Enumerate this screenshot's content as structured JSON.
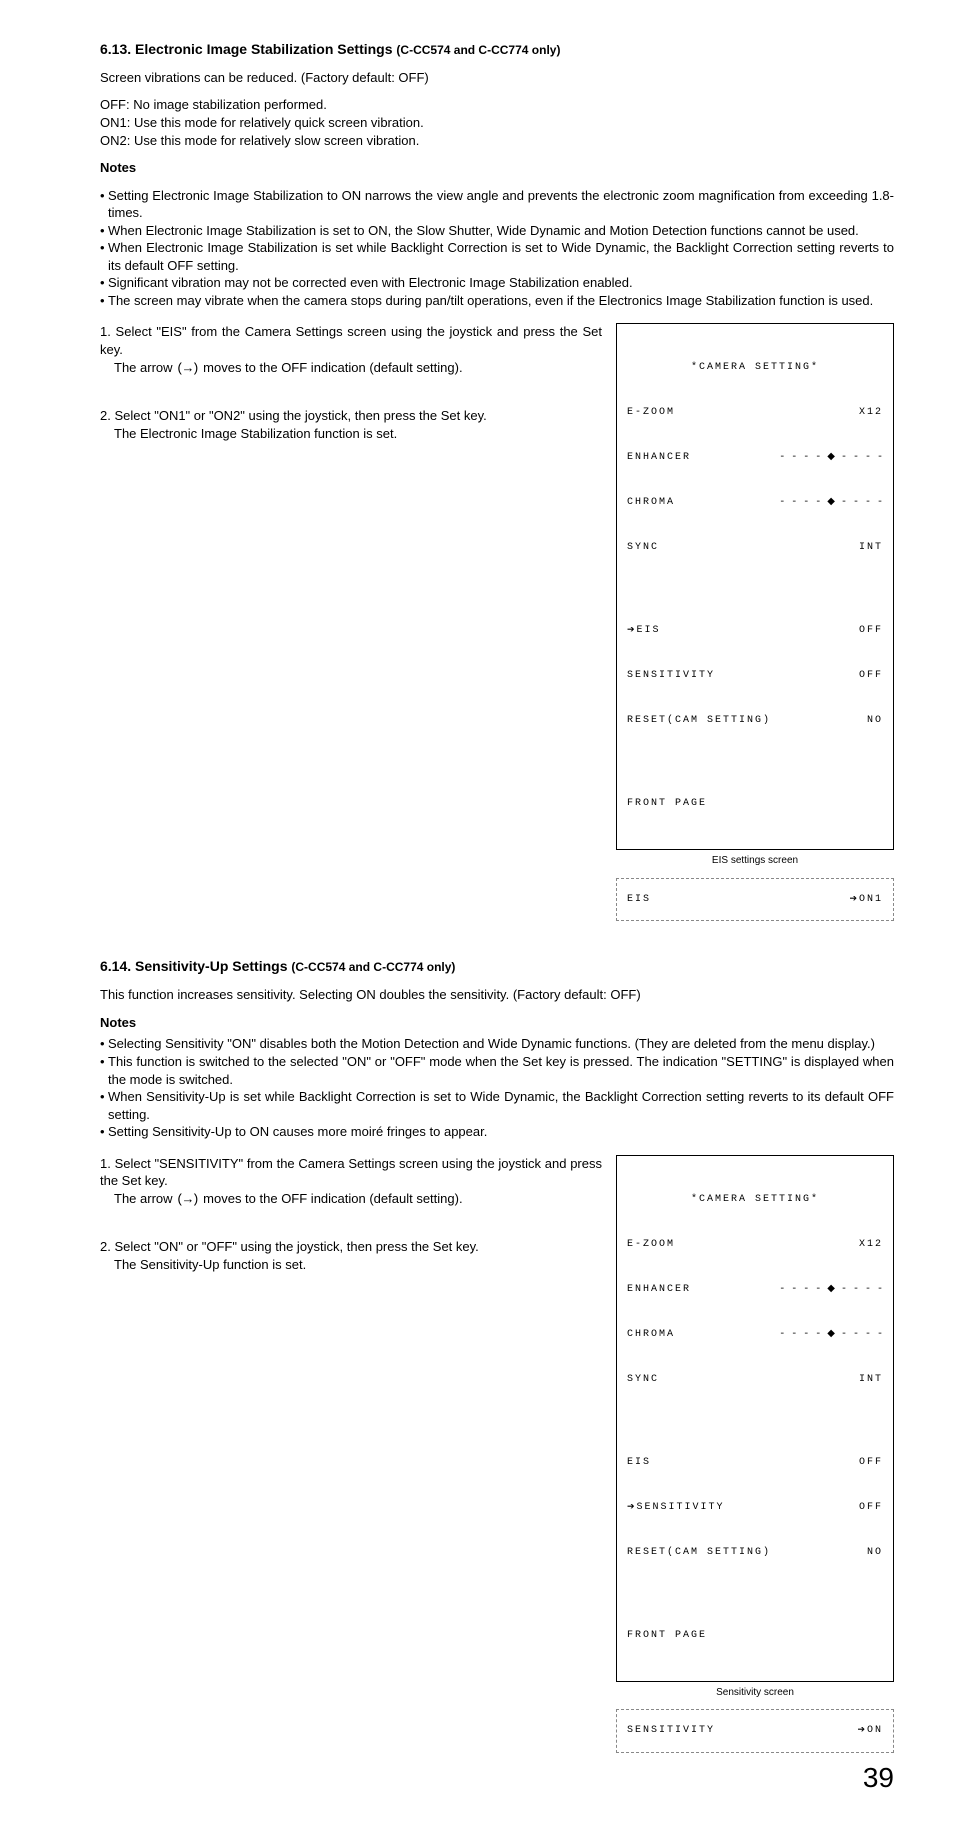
{
  "section613": {
    "title": "6.13. Electronic Image Stabilization Settings ",
    "suffix": "(C-CC574 and C-CC774 only)",
    "intro": "Screen vibrations can be reduced. (Factory default: OFF)",
    "off": "OFF: No image stabilization performed.",
    "on1": "ON1: Use this mode for relatively quick screen vibration.",
    "on2": "ON2: Use this mode for relatively slow screen vibration.",
    "notes_label": "Notes",
    "bullets": [
      "Setting Electronic Image Stabilization to ON narrows the view angle and prevents the electronic zoom magnification from exceeding 1.8-times.",
      "When Electronic Image Stabilization is set to ON, the Slow Shutter, Wide Dynamic and Motion Detection functions cannot be used.",
      "When Electronic Image Stabilization is set while Backlight Correction is set to Wide Dynamic, the Backlight Correction setting reverts to its default OFF setting.",
      "Significant vibration may not be corrected even with Electronic Image Stabilization enabled.",
      "The screen may vibrate when the camera stops during pan/tilt operations, even if the Electronics Image Stabilization function is used."
    ],
    "step1_num": "1.",
    "step1_line1": "Select \"EIS\" from the Camera Settings screen using the joystick and press the Set key.",
    "step1_line2a": "The arrow ",
    "step1_arrow": "(→)",
    "step1_line2b": " moves to the OFF indication (default setting).",
    "step2_num": "2.",
    "step2_line1": "Select \"ON1\" or \"ON2\" using the joystick, then press the Set key.",
    "step2_line2": "The Electronic Image Stabilization function is set.",
    "screen_caption": "EIS settings screen",
    "dash_label": "EIS",
    "dash_value": "ON1"
  },
  "section614": {
    "title": "6.14. Sensitivity-Up Settings ",
    "suffix": "(C-CC574 and C-CC774 only)",
    "intro": "This function increases sensitivity. Selecting ON doubles the sensitivity. (Factory default: OFF)",
    "notes_label": "Notes",
    "bullets": [
      "Selecting Sensitivity \"ON\" disables both the Motion Detection and Wide Dynamic functions. (They are deleted from the menu display.)",
      "This function is switched to the selected \"ON\" or \"OFF\" mode when the Set key is pressed. The indication \"SETTING\" is displayed when the mode is switched.",
      "When Sensitivity-Up is set while Backlight Correction is set to Wide Dynamic, the Backlight Correction setting reverts to its default OFF setting.",
      "Setting Sensitivity-Up to ON causes more moiré fringes to appear."
    ],
    "step1_num": "1.",
    "step1_line1": "Select \"SENSITIVITY\" from the Camera Settings screen using the joystick and press the Set key.",
    "step1_line2a": "The arrow ",
    "step1_arrow": "(→)",
    "step1_line2b": " moves to the OFF indication (default setting).",
    "step2_num": "2.",
    "step2_line1": "Select \"ON\" or \"OFF\" using the joystick, then press the Set key.",
    "step2_line2": "The Sensitivity-Up function is set.",
    "screen_caption": "Sensitivity  screen",
    "dash_label": "SENSITIVITY",
    "dash_value": "ON"
  },
  "camera_screen": {
    "title": "*CAMERA SETTING*",
    "ezoom_label": "E-ZOOM",
    "ezoom_value": "X12",
    "enhancer_label": "ENHANCER",
    "chroma_label": "CHROMA",
    "sync_label": "SYNC",
    "sync_value": "INT",
    "eis_label": "EIS",
    "eis_value": "OFF",
    "sensitivity_label": "SENSITIVITY",
    "sensitivity_value": "OFF",
    "reset_label": "RESET(CAM SETTING)",
    "reset_value": "NO",
    "front_page": "FRONT PAGE",
    "slider": "- - - - ◆ - - - -"
  },
  "page_number": "39"
}
